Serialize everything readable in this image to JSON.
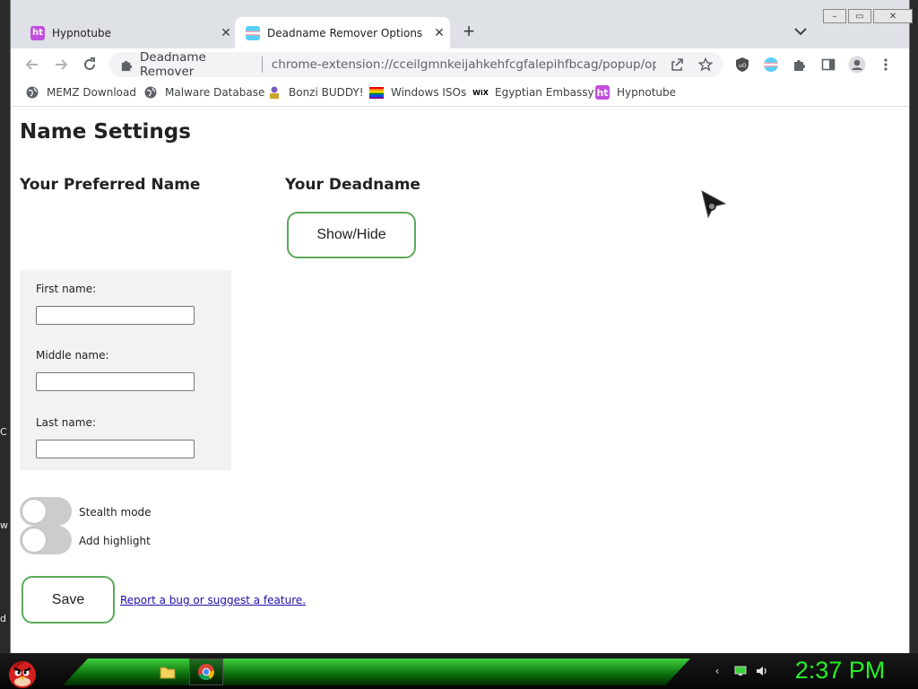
{
  "browser": {
    "tabs": [
      {
        "title": "Hypnotube",
        "icon": "hypnotube-favicon",
        "active": false
      },
      {
        "title": "Deadname Remover Options",
        "icon": "trans-flag-favicon",
        "active": true
      }
    ],
    "window_controls": {
      "minimize": "–",
      "maximize": "▭",
      "close": "✕"
    },
    "omnibox": {
      "extension_name": "Deadname Remover",
      "url": "chrome-extension://cceilgmnkeijahkehfcgfalepihfbcag/popup/option..."
    },
    "bookmarks": [
      {
        "label": "MEMZ Download",
        "icon": "globe-icon"
      },
      {
        "label": "Malware Database",
        "icon": "globe-icon"
      },
      {
        "label": "Bonzi BUDDY!",
        "icon": "bonzi-icon"
      },
      {
        "label": "Windows ISOs",
        "icon": "rainbow-flag-icon"
      },
      {
        "label": "Egyptian Embassy",
        "icon": "wix-icon"
      },
      {
        "label": "Hypnotube",
        "icon": "hypnotube-favicon"
      }
    ],
    "favicon_ht": "ht",
    "wix_label": "WiX"
  },
  "page": {
    "title": "Name Settings",
    "preferred_heading": "Your Preferred Name",
    "deadname_heading": "Your Deadname",
    "show_hide_label": "Show/Hide",
    "fields": {
      "first_name_label": "First name:",
      "middle_name_label": "Middle name:",
      "middle_name_value": "",
      "last_name_label": "Last name:",
      "last_name_value": ""
    },
    "toggles": [
      {
        "label": "Stealth mode",
        "on": false
      },
      {
        "label": "Add highlight",
        "on": false
      }
    ],
    "save_label": "Save",
    "report_link": "Report a bug or suggest a feature."
  },
  "desktop_fragments": [
    "C",
    "w",
    "d"
  ],
  "taskbar": {
    "clock": "2:37 PM",
    "glow_color": "#25f025"
  },
  "colors": {
    "accent_green": "#5aa85a",
    "link": "#1a0dab"
  }
}
